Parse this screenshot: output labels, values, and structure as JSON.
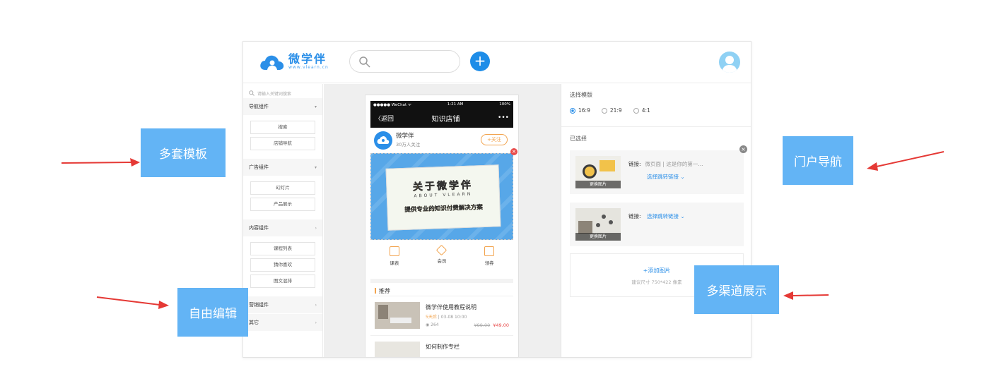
{
  "brand": {
    "name": "微学伴",
    "url": "www.vlearn.cn",
    "primary_color": "#2b8fe8",
    "accent_color": "#f2a34d",
    "callout_color": "#63b4f5",
    "arrow_color": "#e53935"
  },
  "header": {
    "search_placeholder": "",
    "add_icon": "plus-icon",
    "add_symbol": "+",
    "avatar_icon": "user-avatar-icon"
  },
  "sidebar": {
    "search_placeholder": "请输入关键词搜索",
    "groups": [
      {
        "title": "导航组件",
        "caret": "▾",
        "items": [
          "搜索",
          "店铺导航"
        ]
      },
      {
        "title": "广告组件",
        "caret": "▾",
        "items": [
          "幻灯片",
          "产品展示"
        ]
      },
      {
        "title": "内容组件",
        "caret": "›",
        "items": [
          "课程列表",
          "猜你喜欢",
          "图文混排"
        ]
      },
      {
        "title": "营销组件",
        "caret": "›",
        "items": []
      },
      {
        "title": "其它",
        "caret": "›",
        "items": []
      }
    ]
  },
  "phone": {
    "status_left": "●●●●● WeChat ᯤ",
    "status_time": "1:21 AM",
    "status_right": "100%",
    "back_label": "〈返回",
    "title": "知识店铺",
    "more": "•••",
    "shop_name": "微学伴",
    "shop_fans": "30万人关注",
    "follow_label": "+关注",
    "close_symbol": "×",
    "banner_title": "关于微学伴",
    "banner_sub": "ABOUT VLEARN",
    "banner_desc": "提供专业的知识付费解决方案",
    "quick": [
      "课表",
      "会员",
      "领券"
    ],
    "section_title": "推荐",
    "courses": [
      {
        "title": "微学伴使用教程说明",
        "tag": "5天后",
        "date": "03-08 10:00",
        "views": "264",
        "old_price": "¥99.00",
        "price": "¥49.00"
      },
      {
        "title": "如何制作专栏",
        "tag": "",
        "date": "",
        "views": "",
        "old_price": "",
        "price": ""
      }
    ]
  },
  "props": {
    "template_label": "选择模版",
    "ratios": [
      {
        "label": "16:9",
        "selected": true
      },
      {
        "label": "21:9",
        "selected": false
      },
      {
        "label": "4:1",
        "selected": false
      }
    ],
    "selected_label": "已选择",
    "links": [
      {
        "link_label": "链接:",
        "link_value": "微页面 | 这是你的第一...",
        "select_label": "选择跳转链接 ⌄",
        "change_label": "更换图片"
      },
      {
        "link_label": "链接:",
        "link_value": "",
        "select_label": "选择跳转链接 ⌄",
        "change_label": "更换图片"
      }
    ],
    "close_symbol": "×",
    "add_image_label": "+添加图片",
    "add_image_hint": "建议尺寸 750*422 像素"
  },
  "callouts": {
    "templates": "多套模板",
    "free_edit": "自由编辑",
    "portal_nav": "门户导航",
    "multi_channel": "多渠道展示"
  }
}
